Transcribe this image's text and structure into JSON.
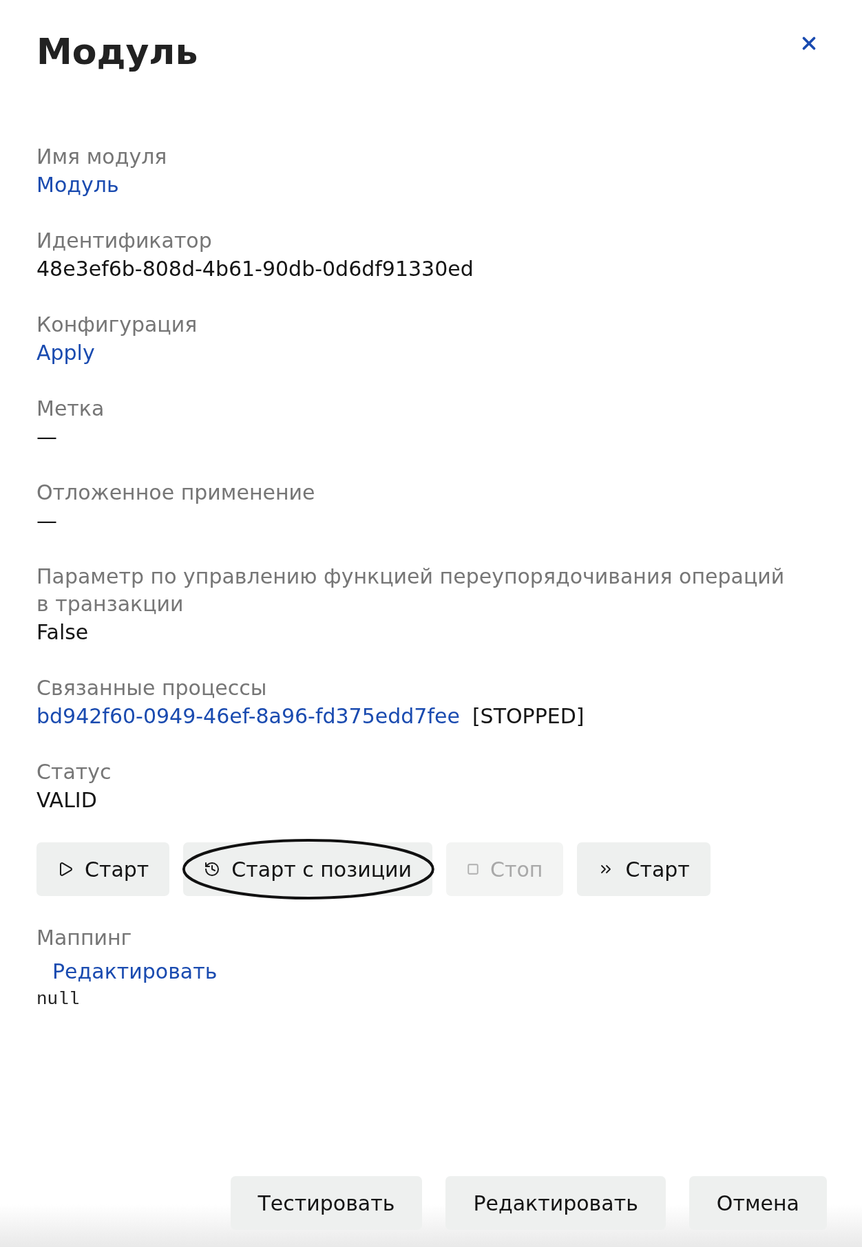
{
  "dialog": {
    "title": "Модуль"
  },
  "fields": [
    {
      "kind": "link",
      "label": "Имя модуля",
      "value": "Модуль"
    },
    {
      "kind": "text",
      "label": "Идентификатор",
      "value": "48e3ef6b-808d-4b61-90db-0d6df91330ed"
    },
    {
      "kind": "link",
      "label": "Конфигурация",
      "value": "Apply"
    },
    {
      "kind": "text",
      "label": "Метка",
      "value": "—"
    },
    {
      "kind": "text",
      "label": "Отложенное применение",
      "value": "—"
    },
    {
      "kind": "text",
      "label": "Параметр по управлению функцией переупорядочивания операций в транзакции",
      "value": "False"
    },
    {
      "kind": "process",
      "label": "Связанные процессы",
      "value": "bd942f60-0949-46ef-8a96-fd375edd7fee",
      "status": "[STOPPED]"
    },
    {
      "kind": "text",
      "label": "Статус",
      "value": "VALID"
    }
  ],
  "actions": [
    {
      "kind": "play",
      "label": "Старт",
      "disabled": false,
      "circled": false
    },
    {
      "kind": "history",
      "label": "Старт с позиции",
      "disabled": false,
      "circled": true
    },
    {
      "kind": "stop",
      "label": "Стоп",
      "disabled": true,
      "circled": false
    },
    {
      "kind": "skip",
      "label": "Старт",
      "disabled": false,
      "circled": false
    }
  ],
  "mapping": {
    "label": "Маппинг",
    "edit_link": "Редактировать",
    "value": "null"
  },
  "footer_buttons": [
    "Тестировать",
    "Редактировать",
    "Отмена"
  ]
}
